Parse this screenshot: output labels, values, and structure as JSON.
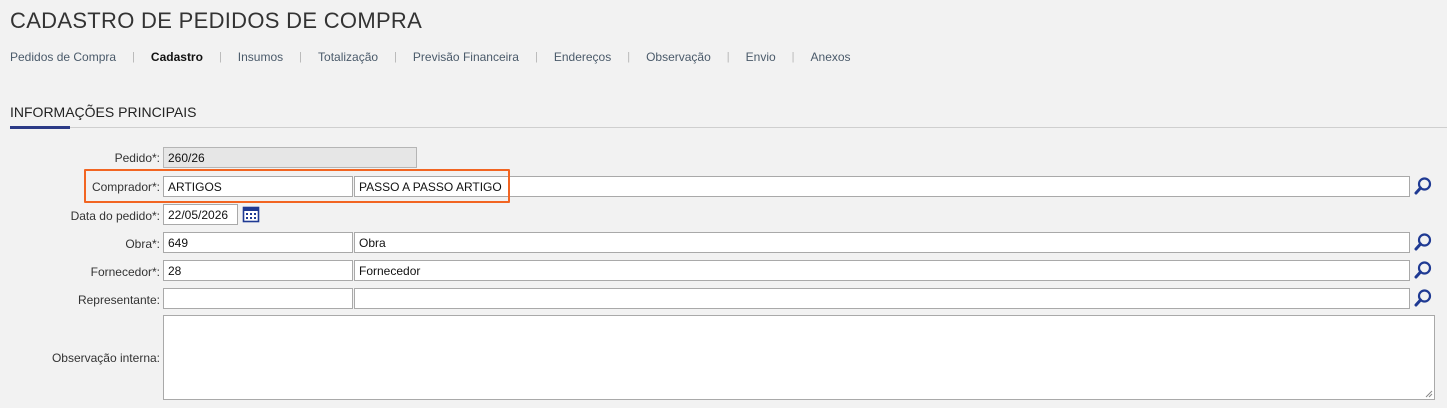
{
  "page": {
    "title": "CADASTRO DE PEDIDOS DE COMPRA"
  },
  "tabs": [
    {
      "label": "Pedidos de Compra"
    },
    {
      "label": "Cadastro"
    },
    {
      "label": "Insumos"
    },
    {
      "label": "Totalização"
    },
    {
      "label": "Previsão Financeira"
    },
    {
      "label": "Endereços"
    },
    {
      "label": "Observação"
    },
    {
      "label": "Envio"
    },
    {
      "label": "Anexos"
    }
  ],
  "tab_separator": "|",
  "section": {
    "title": "INFORMAÇÕES PRINCIPAIS"
  },
  "form": {
    "pedido": {
      "label": "Pedido*:",
      "value": "260/26"
    },
    "comprador": {
      "label": "Comprador*:",
      "code": "ARTIGOS",
      "name": "PASSO A PASSO ARTIGO"
    },
    "data_pedido": {
      "label": "Data do pedido*:",
      "value": "22/05/2026"
    },
    "obra": {
      "label": "Obra*:",
      "code": "649",
      "name": "Obra"
    },
    "fornecedor": {
      "label": "Fornecedor*:",
      "code": "28",
      "name": "Fornecedor"
    },
    "representante": {
      "label": "Representante:",
      "code": "",
      "name": ""
    },
    "observacao_interna": {
      "label": "Observação interna:",
      "value": ""
    }
  },
  "colors": {
    "accent": "#2b3a86",
    "highlight": "#f26522",
    "icon": "#1f3a93"
  }
}
